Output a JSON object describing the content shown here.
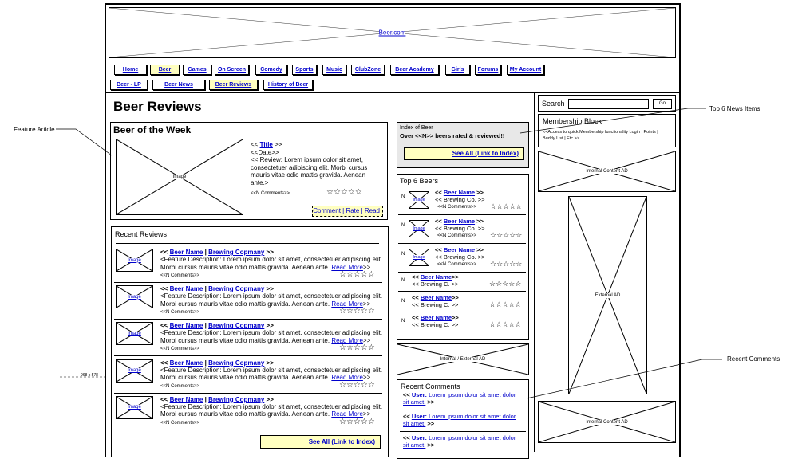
{
  "banner": {
    "label": "Beer.com"
  },
  "nav": [
    "Home",
    "Beer",
    "Games",
    "On Screen",
    "Comedy",
    "Sports",
    "Music",
    "ClubZone",
    "Beer Academy",
    "Girls",
    "Forums",
    "My Account"
  ],
  "subnav": [
    "Beer - LP",
    "Beer News",
    "Beer Reviews",
    "History of Beer"
  ],
  "page_title": "Beer Reviews",
  "feature": {
    "heading": "Beer of the Week",
    "image_label": "Image",
    "title_pre": "<< ",
    "title": "Title",
    "title_post": " >>",
    "date": "<<Date>>",
    "review": "<< Review: Lorem ipsum dolor sit amet, consectetuer adipiscing elit.  Morbi cursus mauris vitae odio mattis gravida. Aenean ante.>",
    "comments": "<<N Comments>>",
    "stars": "☆☆☆☆☆",
    "actions": "Comment | Rate | Read"
  },
  "recent_reviews": {
    "heading": "Recent Reviews",
    "items": [
      {
        "img": "Image",
        "lt": "<< ",
        "beer": "Beer Name",
        "sep": " | ",
        "brewery": "Brewing Copmany",
        "gt": " >>",
        "desc": "<Feature Description: Lorem ipsum dolor sit amet, consectetuer adipiscing elit. Morbi cursus mauris vitae odio mattis gravida. Aenean ante. ",
        "more": "Read More",
        "end": ">>",
        "comments": "<<N Comments>>",
        "stars": "☆☆☆☆☆"
      },
      {
        "img": "Image",
        "lt": "<< ",
        "beer": "Beer Name",
        "sep": " | ",
        "brewery": "Brewing Copmany",
        "gt": " >>",
        "desc": "<Feature Description: Lorem ipsum dolor sit amet, consectetuer adipiscing elit. Morbi cursus mauris vitae odio mattis gravida. Aenean ante. ",
        "more": "Read More",
        "end": ">>",
        "comments": "<<N Comments>>",
        "stars": "☆☆☆☆☆"
      },
      {
        "img": "Image",
        "lt": "<< ",
        "beer": "Beer Name",
        "sep": " | ",
        "brewery": "Brewing Copmany",
        "gt": " >>",
        "desc": "<Feature Description: Lorem ipsum dolor sit amet, consectetuer adipiscing elit. Morbi cursus mauris vitae odio mattis gravida. Aenean ante. ",
        "more": "Read More",
        "end": ">>",
        "comments": "<<N Comments>>",
        "stars": "☆☆☆☆☆"
      },
      {
        "img": "Image",
        "lt": "<< ",
        "beer": "Beer Name",
        "sep": " | ",
        "brewery": "Brewing Copmany",
        "gt": " >>",
        "desc": "<Feature Description: Lorem ipsum dolor sit amet, consectetuer adipiscing elit. Morbi cursus mauris vitae odio mattis gravida. Aenean ante. ",
        "more": "Read More",
        "end": ">>",
        "comments": "<<N Comments>>",
        "stars": "☆☆☆☆☆"
      },
      {
        "img": "Image",
        "lt": "<< ",
        "beer": "Beer Name",
        "sep": " | ",
        "brewery": "Brewing Copmany",
        "gt": " >>",
        "desc": "<Feature Description: Lorem ipsum dolor sit amet, consectetuer adipiscing elit. Morbi cursus mauris vitae odio mattis gravida. Aenean ante. ",
        "more": "Read More",
        "end": ">>",
        "comments": "<<N Comments>>",
        "stars": "☆☆☆☆☆"
      }
    ],
    "see_all": "See All (Link to Index)"
  },
  "index": {
    "line1": "Index of Beer",
    "line2": "Over <<N>> beers rated & reviewed!!",
    "see_all": "See All (Link to Index)"
  },
  "top6": {
    "heading": "Top 6 Beers",
    "with_image": [
      {
        "n": "N",
        "img": "Image",
        "lt": "<< ",
        "beer": "Beer Name",
        "gt": " >>",
        "brew": "<< Brewing Co.  >>",
        "comments": "<<N Comments>>",
        "stars": "☆☆☆☆☆"
      },
      {
        "n": "N",
        "img": "Image",
        "lt": "<< ",
        "beer": "Beer Name",
        "gt": " >>",
        "brew": "<< Brewing Co.  >>",
        "comments": "<<N Comments>>",
        "stars": "☆☆☆☆☆"
      },
      {
        "n": "N",
        "img": "Image",
        "lt": "<< ",
        "beer": "Beer Name",
        "gt": " >>",
        "brew": "<< Brewing Co.  >>",
        "comments": "<<N Comments>>",
        "stars": "☆☆☆☆☆"
      }
    ],
    "text_only": [
      {
        "n": "N",
        "lt": "<< ",
        "beer": "Beer Name",
        "gt": ">>",
        "brew": "<< Brewing C.  >>",
        "stars": "☆☆☆☆☆"
      },
      {
        "n": "N",
        "lt": "<< ",
        "beer": "Beer Name",
        "gt": ">>",
        "brew": "<< Brewing C.  >>",
        "stars": "☆☆☆☆☆"
      },
      {
        "n": "N",
        "lt": "<< ",
        "beer": "Beer Name",
        "gt": ">>",
        "brew": "<< Brewing C.  >>",
        "stars": "☆☆☆☆☆"
      }
    ]
  },
  "mid_ad": "Internal / External AD",
  "recent_comments": {
    "heading": "Recent Comments",
    "items": [
      {
        "lt": "<< ",
        "user": "User:",
        "text": " Lorem ipsum dolor sit amet dolor sit amet.",
        "gt": " >>"
      },
      {
        "lt": "<< ",
        "user": "User:",
        "text": " Lorem ipsum dolor sit amet dolor sit amet.",
        "gt": " >>"
      },
      {
        "lt": "<< ",
        "user": "User:",
        "text": " Lorem ipsum dolor sit amet dolor sit amet.",
        "gt": " >>"
      }
    ]
  },
  "sidebar": {
    "search_label": "Search",
    "go": "Go",
    "membership_heading": "Membership Block",
    "membership_text": "<<Access to quick Membership functionality  Login | Points | Buddy List | Etc >>",
    "ad_top": "Internal Content AD",
    "ad_external": "External AD",
    "ad_bottom": "Internal Content AD"
  },
  "annotations": {
    "feature": "Feature Article",
    "top6": "Top 6 News Items",
    "comments": "Recent Comments",
    "size": "968 x 578"
  }
}
